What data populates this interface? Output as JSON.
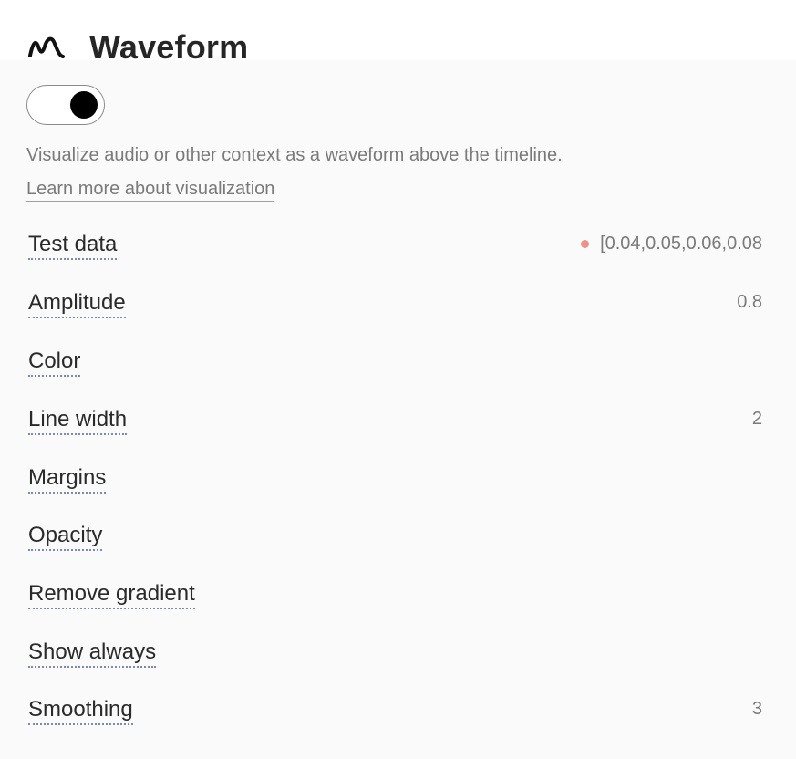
{
  "header": {
    "title": "Waveform",
    "icon": "waveform-icon"
  },
  "toggle": {
    "state": "on"
  },
  "description": "Visualize audio or other context as a waveform above the timeline.",
  "learn_more_link": "Learn more about visualization",
  "colors": {
    "error_dot": "#f0908a",
    "toggle_knob": "#000000"
  },
  "properties": [
    {
      "label": "Test data",
      "value": "[0.04,0.05,0.06,0.08",
      "indicator": "error-dot"
    },
    {
      "label": "Amplitude",
      "value": "0.8"
    },
    {
      "label": "Color",
      "value": ""
    },
    {
      "label": "Line width",
      "value": "2"
    },
    {
      "label": "Margins",
      "value": ""
    },
    {
      "label": "Opacity",
      "value": ""
    },
    {
      "label": "Remove gradient",
      "value": ""
    },
    {
      "label": "Show always",
      "value": ""
    },
    {
      "label": "Smoothing",
      "value": "3"
    }
  ]
}
